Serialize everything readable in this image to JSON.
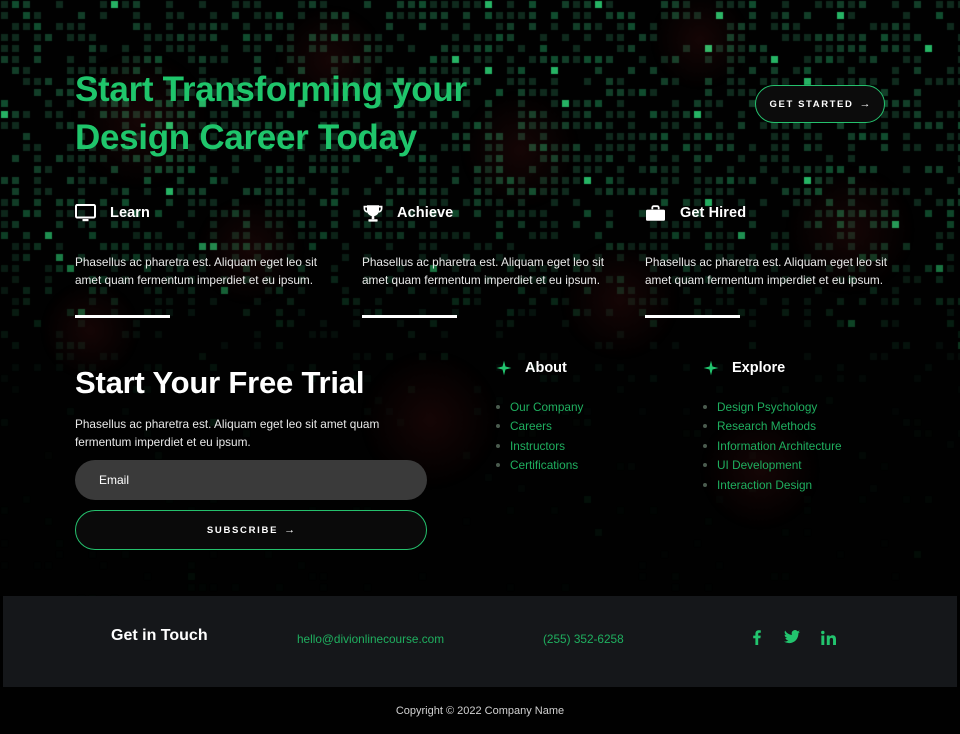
{
  "hero": {
    "title_line1": "Start Transforming your",
    "title_line2": "Design Career Today",
    "cta_label": "GET STARTED",
    "cta_arrow": "→",
    "accent_color": "#1fc56b",
    "background_color": "#010101"
  },
  "features": [
    {
      "icon": "monitor-icon",
      "title": "Learn",
      "body": "Phasellus ac pharetra est. Aliquam eget leo sit amet quam fermentum imperdiet et eu ipsum."
    },
    {
      "icon": "trophy-icon",
      "title": "Achieve",
      "body": "Phasellus ac pharetra est. Aliquam eget leo sit amet quam fermentum imperdiet et eu ipsum."
    },
    {
      "icon": "briefcase-icon",
      "title": "Get Hired",
      "body": "Phasellus ac pharetra est. Aliquam eget leo sit amet quam fermentum imperdiet et eu ipsum."
    }
  ],
  "trial": {
    "title": "Start Your Free Trial",
    "body": "Phasellus ac pharetra est. Aliquam eget leo sit amet quam fermentum imperdiet et eu ipsum.",
    "email_placeholder": "Email",
    "email_value": "",
    "subscribe_label": "SUBSCRIBE",
    "subscribe_arrow": "→"
  },
  "link_columns": [
    {
      "icon": "sparkle-icon",
      "title": "About",
      "links": [
        "Our Company",
        "Careers",
        "Instructors",
        "Certifications"
      ]
    },
    {
      "icon": "sparkle-icon",
      "title": "Explore",
      "links": [
        "Design Psychology",
        "Research Methods",
        "Information Architecture",
        "UI Development",
        "Interaction Design"
      ]
    }
  ],
  "contact": {
    "title": "Get in Touch",
    "email": "hello@divionlinecourse.com",
    "phone": "(255) 352-6258",
    "link_color": "#1faf5f",
    "bar_background": "#15171a",
    "socials": [
      {
        "name": "facebook-icon",
        "label": "f"
      },
      {
        "name": "twitter-icon",
        "label": "t"
      },
      {
        "name": "linkedin-icon",
        "label": "in"
      }
    ]
  },
  "copyright": {
    "text": "Copyright © 2022 Company Name"
  }
}
